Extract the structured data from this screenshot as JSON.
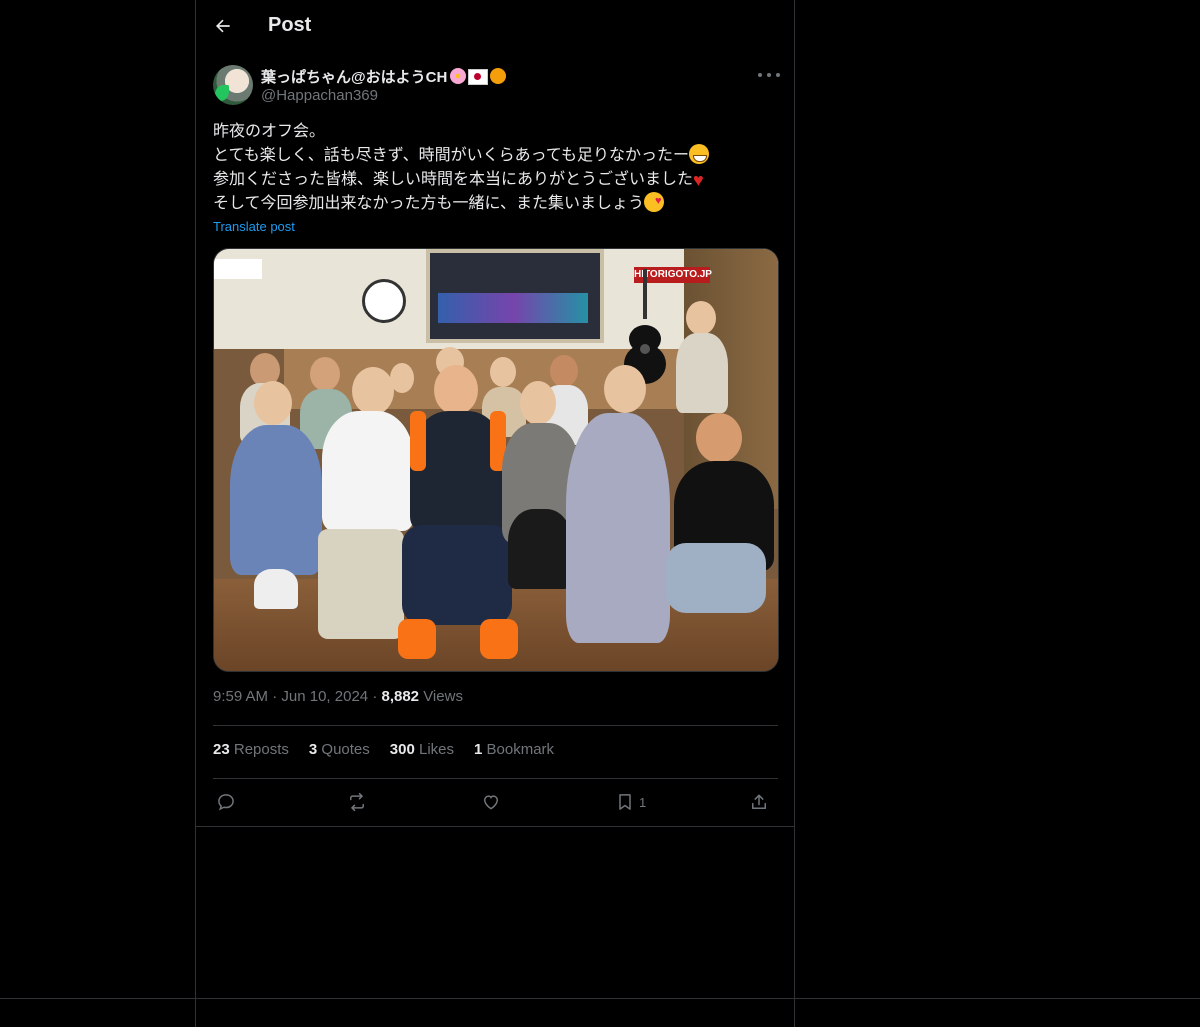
{
  "header": {
    "title": "Post"
  },
  "author": {
    "name": "葉っぱちゃん@おはようCH",
    "handle": "@Happachan369"
  },
  "post": {
    "lines": [
      "昨夜のオフ会。",
      "とても楽しく、話も尽きず、時間がいくらあっても足りなかったー",
      "参加くださった皆様、楽しい時間を本当にありがとうございました",
      "そして今回参加出来なかった方も一緒に、また集いましょう"
    ],
    "translate_label": "Translate post",
    "photo_sign_text": "HITORIGOTO.JP"
  },
  "meta": {
    "time": "9:59 AM",
    "date": "Jun 10, 2024",
    "views_count": "8,882",
    "views_label": "Views"
  },
  "stats": {
    "reposts": {
      "count": "23",
      "label": "Reposts"
    },
    "quotes": {
      "count": "3",
      "label": "Quotes"
    },
    "likes": {
      "count": "300",
      "label": "Likes"
    },
    "bookmarks": {
      "count": "1",
      "label": "Bookmark"
    }
  },
  "actions": {
    "bookmark_count": "1"
  },
  "icons": [
    "back-arrow-icon",
    "more-icon",
    "reply-icon",
    "repost-icon",
    "like-icon",
    "bookmark-icon",
    "share-icon"
  ],
  "colors": {
    "background": "#000000",
    "text": "#e7e9ea",
    "muted": "#71767b",
    "link": "#1d9bf0",
    "border": "#2f3336"
  }
}
